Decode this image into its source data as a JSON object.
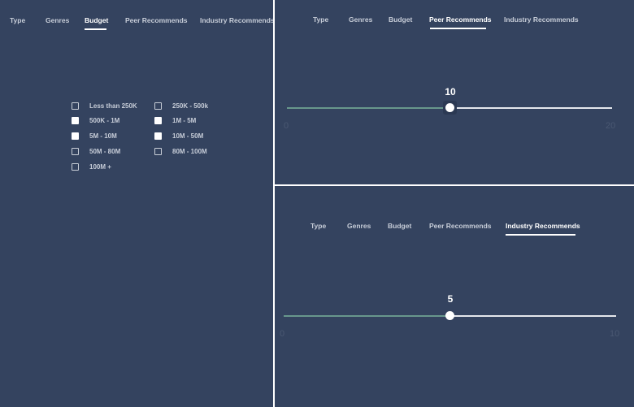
{
  "tabs": [
    "Type",
    "Genres",
    "Budget",
    "Peer Recommends",
    "Industry Recommends"
  ],
  "budget_panel": {
    "active_tab": "Budget",
    "options": [
      {
        "label": "Less than 250K",
        "checked": false
      },
      {
        "label": "250K - 500k",
        "checked": false
      },
      {
        "label": "500K - 1M",
        "checked": true
      },
      {
        "label": "1M - 5M",
        "checked": true
      },
      {
        "label": "5M - 10M",
        "checked": true
      },
      {
        "label": "10M - 50M",
        "checked": true
      },
      {
        "label": "50M - 80M",
        "checked": false
      },
      {
        "label": "80M - 100M",
        "checked": false
      },
      {
        "label": "100M +",
        "checked": false
      }
    ]
  },
  "peer_panel": {
    "active_tab": "Peer Recommends",
    "slider": {
      "value": "10",
      "min": "0",
      "max": "20"
    }
  },
  "industry_panel": {
    "active_tab": "Industry Recommends",
    "slider": {
      "value": "5",
      "min": "0",
      "max": "10"
    }
  },
  "colors": {
    "background": "#34435f",
    "track_filled": "#68978c",
    "track_rest": "#e4e7ec",
    "active_tab": "#ffffff",
    "tab": "#c7cdd8"
  }
}
